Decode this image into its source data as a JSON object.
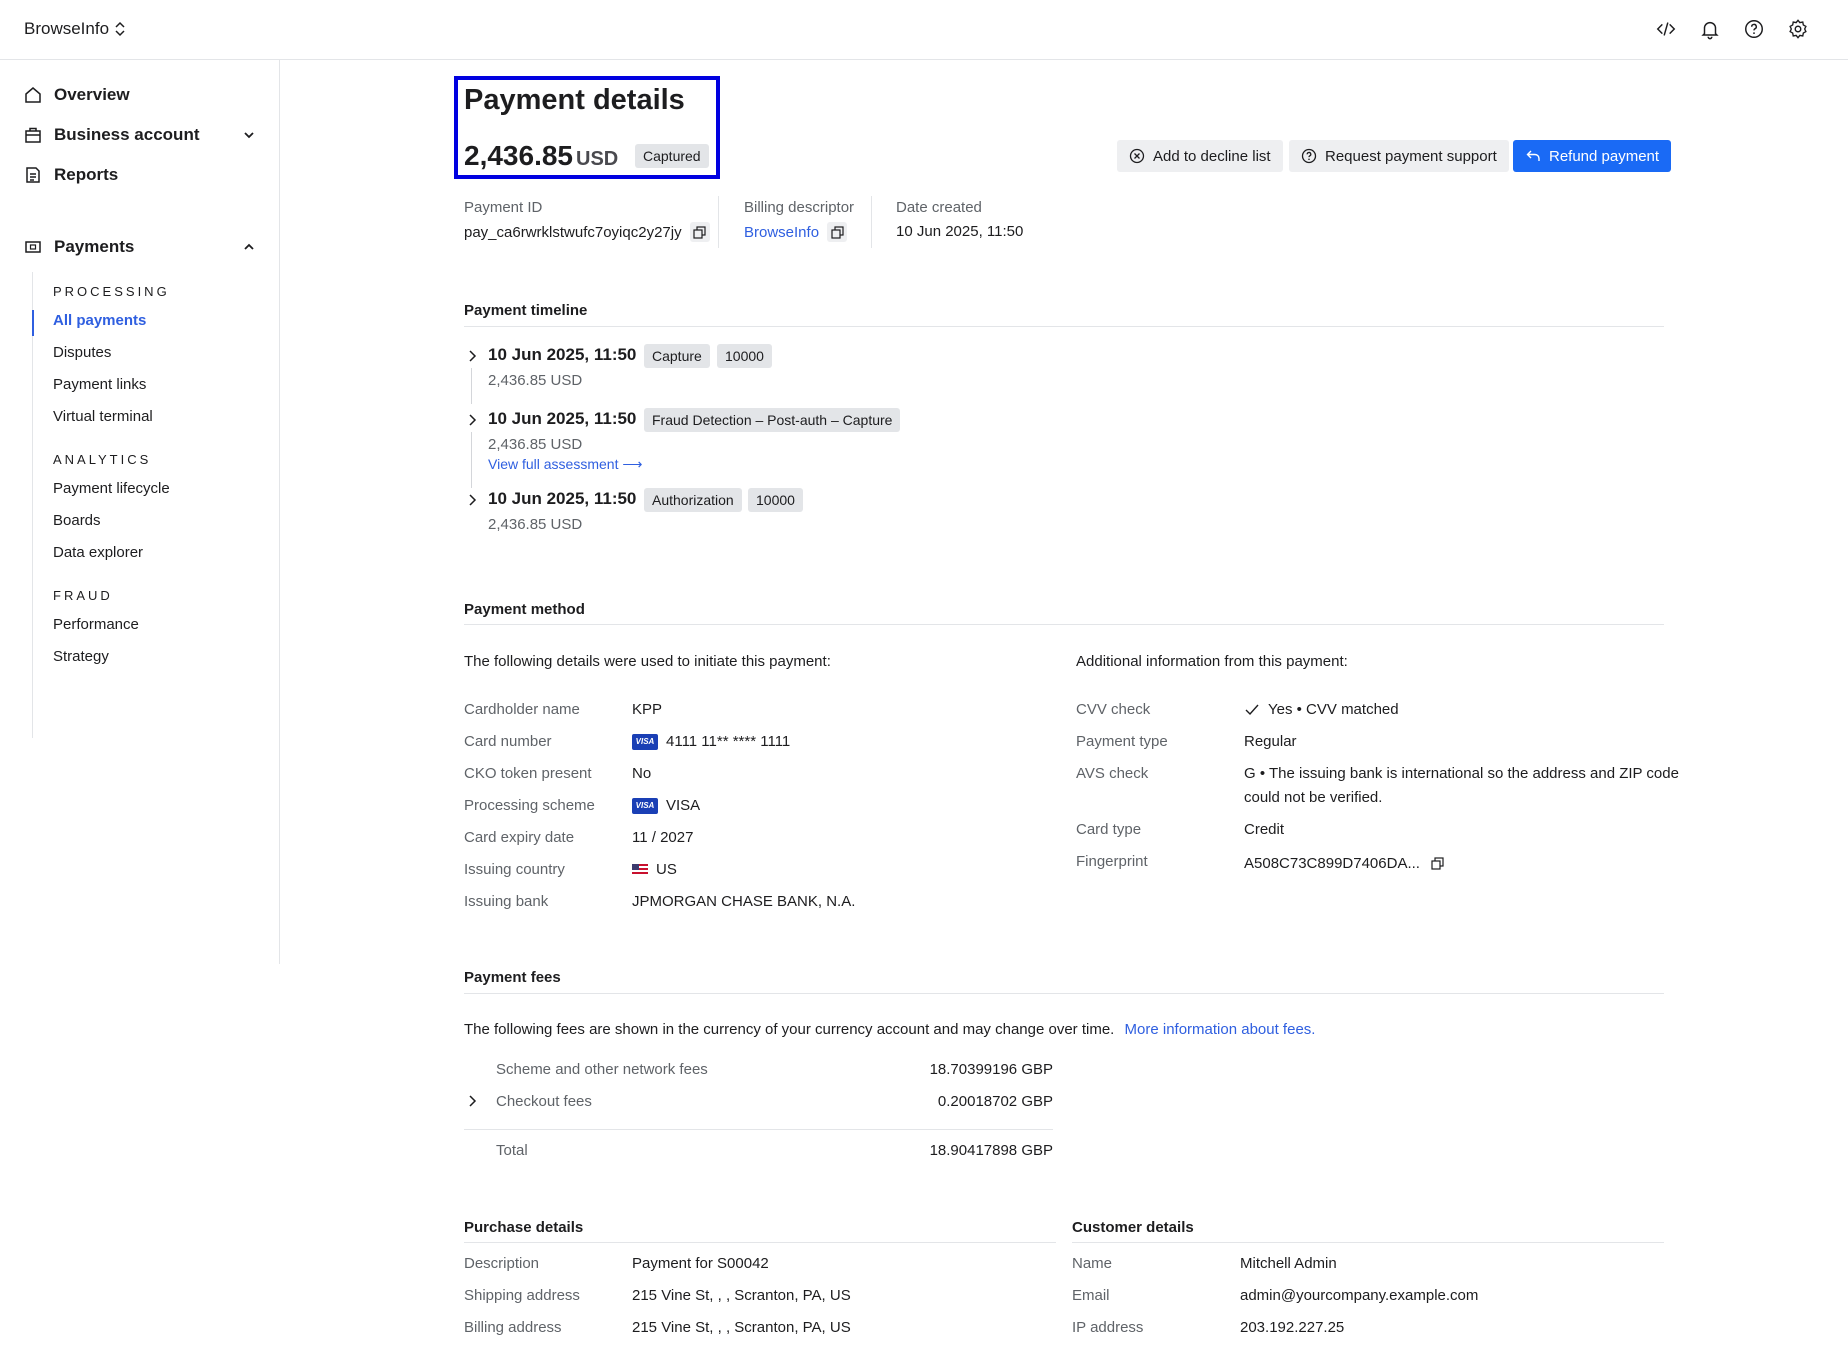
{
  "topbar": {
    "brand": "BrowseInfo"
  },
  "sidebar": {
    "overview": "Overview",
    "business_account": "Business account",
    "reports": "Reports",
    "payments": "Payments",
    "processing_head": "PROCESSING",
    "processing": [
      "All payments",
      "Disputes",
      "Payment links",
      "Virtual terminal"
    ],
    "analytics_head": "ANALYTICS",
    "analytics": [
      "Payment lifecycle",
      "Boards",
      "Data explorer"
    ],
    "fraud_head": "FRAUD",
    "fraud": [
      "Performance",
      "Strategy"
    ]
  },
  "header": {
    "title": "Payment details",
    "amount": "2,436.85",
    "currency": "USD",
    "status": "Captured",
    "btn_decline": "Add to decline list",
    "btn_support": "Request payment support",
    "btn_refund": "Refund payment"
  },
  "meta": {
    "payment_id_label": "Payment ID",
    "payment_id": "pay_ca6rwrklstwufc7oyiqc2y27jy",
    "billing_label": "Billing descriptor",
    "billing": "BrowseInfo",
    "date_label": "Date created",
    "date": "10 Jun 2025, 11:50"
  },
  "timeline": {
    "title": "Payment timeline",
    "events": [
      {
        "date": "10 Jun 2025, 11:50",
        "amount": "2,436.85 USD",
        "type": "Capture",
        "code": "10000"
      },
      {
        "date": "10 Jun 2025, 11:50",
        "amount": "2,436.85 USD",
        "type": "Fraud Detection – Post-auth – Capture",
        "link": "View full assessment"
      },
      {
        "date": "10 Jun 2025, 11:50",
        "amount": "2,436.85 USD",
        "type": "Authorization",
        "code": "10000"
      }
    ]
  },
  "method": {
    "title": "Payment method",
    "left_intro": "The following details were used to initiate this payment:",
    "right_intro": "Additional information from this payment:",
    "left": [
      {
        "label": "Cardholder name",
        "value": "KPP"
      },
      {
        "label": "Card number",
        "value": "4111 11** **** 1111"
      },
      {
        "label": "CKO token present",
        "value": "No"
      },
      {
        "label": "Processing scheme",
        "value": "VISA"
      },
      {
        "label": "Card expiry date",
        "value": "11 / 2027"
      },
      {
        "label": "Issuing country",
        "value": "US"
      },
      {
        "label": "Issuing bank",
        "value": "JPMORGAN CHASE BANK, N.A."
      }
    ],
    "right": [
      {
        "label": "CVV check",
        "value": "Yes • CVV matched"
      },
      {
        "label": "Payment type",
        "value": "Regular"
      },
      {
        "label": "AVS check",
        "value": "G • The issuing bank is international so the address and ZIP code",
        "value2": "could not be verified."
      },
      {
        "label": "Card type",
        "value": "Credit"
      },
      {
        "label": "Fingerprint",
        "value": "A508C73C899D7406DA..."
      }
    ]
  },
  "fees": {
    "title": "Payment fees",
    "intro": "The following fees are shown in the currency of your currency account and may change over time.",
    "link": "More information about fees.",
    "rows": [
      {
        "label": "Scheme and other network fees",
        "value": "18.70399196 GBP"
      },
      {
        "label": "Checkout fees",
        "value": "0.20018702 GBP"
      }
    ],
    "total_label": "Total",
    "total": "18.90417898 GBP"
  },
  "purchase": {
    "title": "Purchase details",
    "rows": [
      {
        "label": "Description",
        "value": "Payment for S00042"
      },
      {
        "label": "Shipping address",
        "value": "215 Vine St, , , Scranton, PA, US"
      },
      {
        "label": "Billing address",
        "value": "215 Vine St, , , Scranton, PA, US"
      }
    ]
  },
  "customer": {
    "title": "Customer details",
    "rows": [
      {
        "label": "Name",
        "value": "Mitchell Admin"
      },
      {
        "label": "Email",
        "value": "admin@yourcompany.example.com"
      },
      {
        "label": "IP address",
        "value": "203.192.227.25"
      }
    ]
  }
}
